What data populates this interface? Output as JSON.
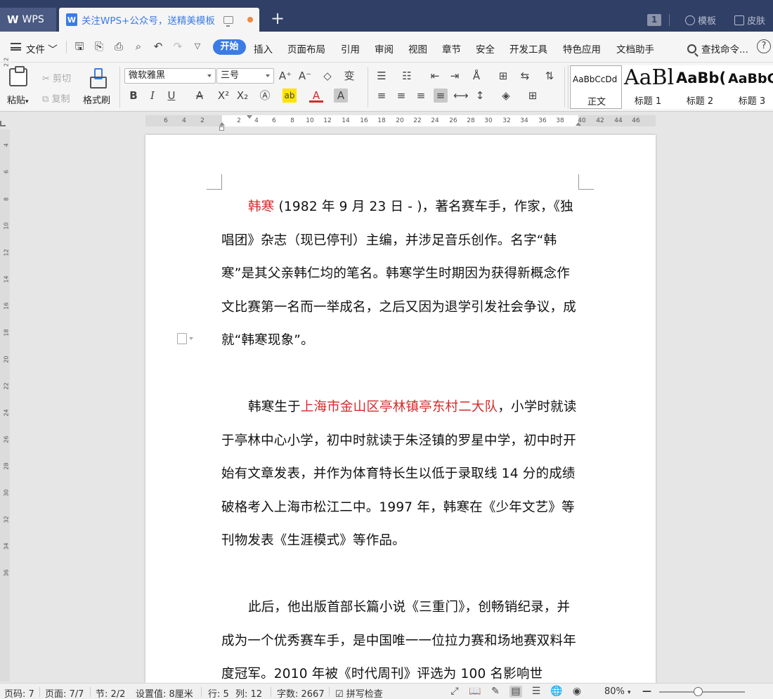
{
  "titlebar": {
    "app_tab": "WPS",
    "doc_tab": "关注WPS+公众号，送精美模板",
    "new_tab": "+",
    "page_count_badge": "1",
    "templates": "模板",
    "skin": "皮肤"
  },
  "menu": {
    "file": "文件",
    "items": [
      "开始",
      "插入",
      "页面布局",
      "引用",
      "审阅",
      "视图",
      "章节",
      "安全",
      "开发工具",
      "特色应用",
      "文档助手"
    ],
    "search": "查找命令...",
    "help": "?"
  },
  "ribbon": {
    "paste": "粘贴",
    "cut": "剪切",
    "copy": "复制",
    "format_painter": "格式刷",
    "font_name": "微软雅黑",
    "font_size": "三号",
    "styles": [
      {
        "preview": "AaBbCcDd",
        "label": "正文"
      },
      {
        "preview": "AaBl",
        "label": "标题 1"
      },
      {
        "preview": "AaBb(",
        "label": "标题 2"
      },
      {
        "preview": "AaBbC",
        "label": "标题 3"
      }
    ]
  },
  "ruler": {
    "ticks": [
      "6",
      "4",
      "2",
      "2",
      "4",
      "6",
      "8",
      "10",
      "12",
      "14",
      "16",
      "18",
      "20",
      "22",
      "24",
      "26",
      "28",
      "30",
      "32",
      "34",
      "36",
      "38",
      "40",
      "42",
      "44",
      "46"
    ],
    "vticks": [
      "2",
      "2",
      "4",
      "6",
      "8",
      "10",
      "12",
      "14",
      "16",
      "18",
      "20",
      "22",
      "24",
      "26",
      "28",
      "30",
      "32",
      "34",
      "36"
    ]
  },
  "document": {
    "p1": {
      "name": "韩寒",
      "text": " (1982 年 9 月 23 日 - )，著名赛车手，作家，《独唱团》杂志（现已停刊）主编，并涉足音乐创作。名字“韩寒”是其父亲韩仁均的笔名。韩寒学生时期因为获得新概念作文比赛第一名而一举成名，之后又因为退学引发社会争议，成就“韩寒现象”。"
    },
    "p2": {
      "pre": "韩寒生于",
      "place": "上海市金山区亭林镇亭东村二大队",
      "text": "，小学时就读于亭林中心小学，初中时就读于朱泾镇的罗星中学，初中时开始有文章发表，并作为体育特长生以低于录取线 14 分的成绩破格考入上海市松江二中。1997 年，韩寒在《少年文艺》等刊物发表《生涯模式》等作品。"
    },
    "p3": {
      "text": "此后，他出版首部长篇小说《三重门》，创畅销纪录，并成为一个优秀赛车手，是中国唯一一位拉力赛和场地赛双料年度冠军。2010 年被《时代周刊》评选为 100 名影响世"
    }
  },
  "status": {
    "page_num": "页码: 7",
    "pages": "页面: 7/7",
    "section": "节: 2/2",
    "setting": "设置值: 8厘米",
    "row": "行: 5",
    "col": "列: 12",
    "words": "字数: 2667",
    "spell": "拼写检查",
    "zoom": "80%",
    "zoom_minus": "—",
    "zoom_level": 0.46
  },
  "colors": {
    "titlebar": "#2f3f66",
    "accent": "#3a7be6",
    "highlight_text": "#d42a2a"
  }
}
